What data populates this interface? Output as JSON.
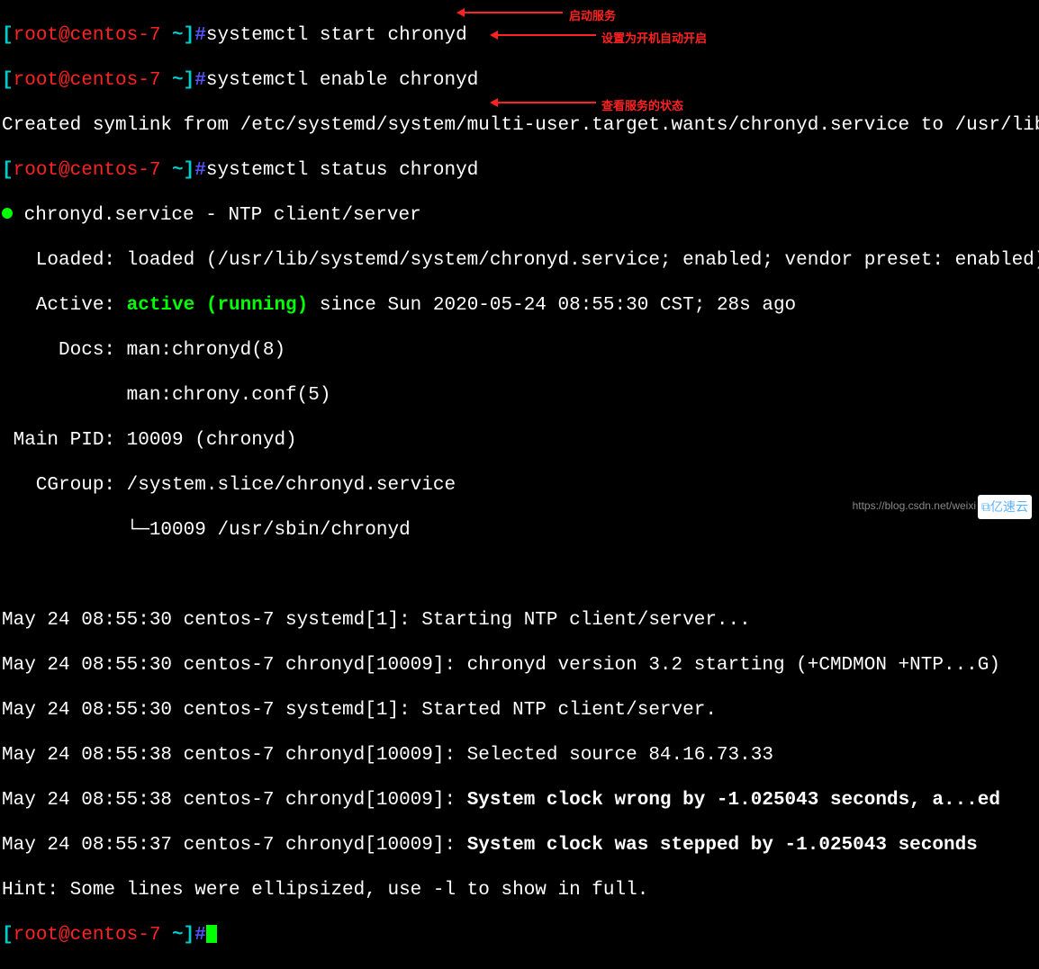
{
  "prompt": {
    "open_bracket": "[",
    "user_host": "root@centos-7",
    "cwd": " ~",
    "close_bracket": "]",
    "hash": "#"
  },
  "commands": {
    "cmd1": "systemctl start chronyd",
    "cmd2": "systemctl enable chronyd",
    "cmd3": "systemctl status chronyd"
  },
  "annotations": {
    "ann1": "启动服务",
    "ann2": "设置为开机自动开启",
    "ann3": "查看服务的状态"
  },
  "output": {
    "symlink": "Created symlink from /etc/systemd/system/multi-user.target.wants/chronyd.service to /usr/lib/systemd/system/chronyd.service.",
    "service_line": " chronyd.service - NTP client/server",
    "loaded": "   Loaded: loaded (/usr/lib/systemd/system/chronyd.service; enabled; vendor preset: enabled)",
    "active_prefix": "   Active: ",
    "active_state": "active (running)",
    "active_suffix": " since Sun 2020-05-24 08:55:30 CST; 28s ago",
    "docs1": "     Docs: man:chronyd(8)",
    "docs2": "           man:chrony.conf(5)",
    "mainpid": " Main PID: 10009 (chronyd)",
    "cgroup1": "   CGroup: /system.slice/chronyd.service",
    "cgroup2": "           └─10009 /usr/sbin/chronyd",
    "log1": "May 24 08:55:30 centos-7 systemd[1]: Starting NTP client/server...",
    "log2": "May 24 08:55:30 centos-7 chronyd[10009]: chronyd version 3.2 starting (+CMDMON +NTP...G)",
    "log3": "May 24 08:55:30 centos-7 systemd[1]: Started NTP client/server.",
    "log4": "May 24 08:55:38 centos-7 chronyd[10009]: Selected source 84.16.73.33",
    "log5_prefix": "May 24 08:55:38 centos-7 chronyd[10009]: ",
    "log5_bold": "System clock wrong by -1.025043 seconds, a...ed",
    "log6_prefix": "May 24 08:55:37 centos-7 chronyd[10009]: ",
    "log6_bold": "System clock was stepped by -1.025043 seconds",
    "hint": "Hint: Some lines were ellipsized, use -l to show in full."
  },
  "watermark": "https://blog.csdn.net/weixi",
  "logo": "⧉亿速云"
}
